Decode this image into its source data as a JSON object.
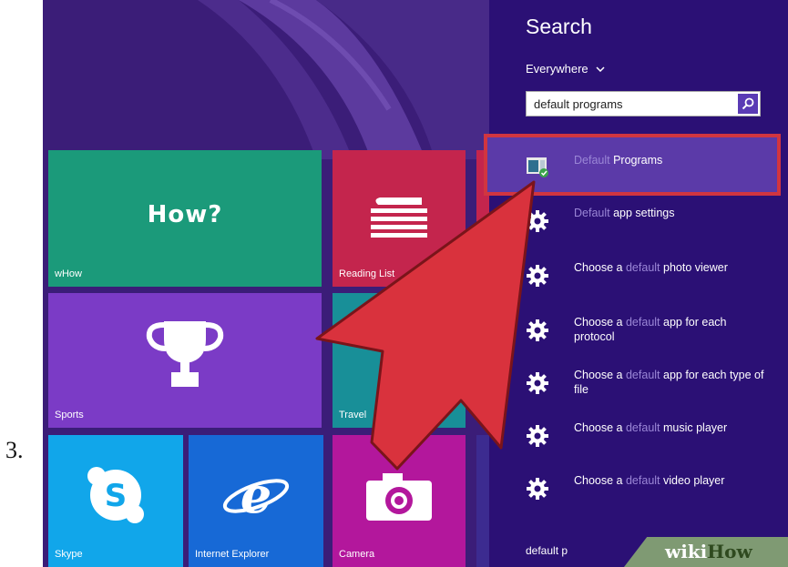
{
  "step_number": "3.",
  "tiles": {
    "whow": {
      "label": "wHow",
      "center_text": "How?",
      "color": "#1b9a7a"
    },
    "reading_list": {
      "label": "Reading List",
      "color": "#c4254d"
    },
    "sports": {
      "label": "Sports",
      "color": "#7b3bc6"
    },
    "travel": {
      "label": "Travel",
      "color": "#188f98"
    },
    "skype": {
      "label": "Skype",
      "color": "#11a6ea"
    },
    "internet_explorer": {
      "label": "Internet Explorer",
      "color": "#1769d6"
    },
    "camera": {
      "label": "Camera",
      "color": "#b3179c"
    }
  },
  "search_panel": {
    "title": "Search",
    "scope": "Everywhere",
    "query": "default programs",
    "results": [
      {
        "pre": "",
        "hl": "Default",
        "post": " Programs",
        "icon": "default-programs-icon"
      },
      {
        "pre": "",
        "hl": "Default",
        "post": " app settings",
        "icon": "gear-icon"
      },
      {
        "pre": "Choose a ",
        "hl": "default",
        "post": " photo viewer",
        "icon": "gear-icon"
      },
      {
        "pre": "Choose a ",
        "hl": "default",
        "post": " app for each protocol",
        "icon": "gear-icon"
      },
      {
        "pre": "Choose a ",
        "hl": "default",
        "post": " app for each type of file",
        "icon": "gear-icon"
      },
      {
        "pre": "Choose a ",
        "hl": "default",
        "post": " music player",
        "icon": "gear-icon"
      },
      {
        "pre": "Choose a ",
        "hl": "default",
        "post": " video player",
        "icon": "gear-icon"
      }
    ],
    "footer_query": "default p"
  },
  "watermark": {
    "wiki": "wiki",
    "how": "How"
  },
  "colors": {
    "panel": "#2b1075",
    "highlight_border": "#d13540",
    "arrow": "#d9323d"
  }
}
